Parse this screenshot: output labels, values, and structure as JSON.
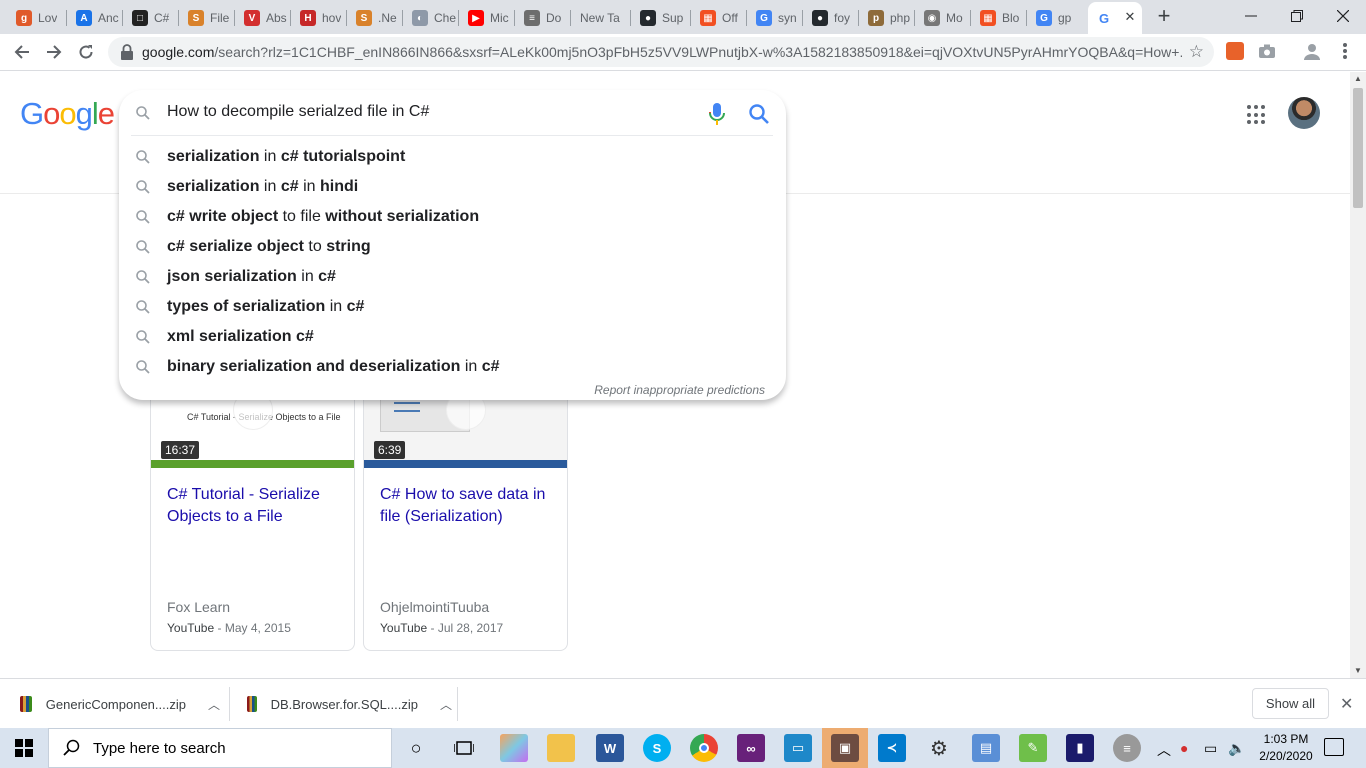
{
  "browser": {
    "tabs": [
      {
        "label": "Lov",
        "favicon": "ginger-favicon",
        "color": "#e05a2a",
        "glyph": "g"
      },
      {
        "label": "Anc",
        "favicon": "android-favicon",
        "color": "#1a73e8",
        "glyph": "A"
      },
      {
        "label": "C#",
        "favicon": "tutorial-favicon",
        "color": "#222222",
        "glyph": "□"
      },
      {
        "label": "File",
        "favicon": "stackoverflow-favicon",
        "color": "#d9822b",
        "glyph": "S"
      },
      {
        "label": "Abs",
        "favicon": "v-favicon",
        "color": "#d32f2f",
        "glyph": "V"
      },
      {
        "label": "hov",
        "favicon": "h-favicon",
        "color": "#c62828",
        "glyph": "H"
      },
      {
        "label": ".Ne",
        "favicon": "stackoverflow-favicon",
        "color": "#d9822b",
        "glyph": "S"
      },
      {
        "label": "Che",
        "favicon": "chrome-ext-favicon",
        "color": "#8e99a8",
        "glyph": "◐"
      },
      {
        "label": "Mic",
        "favicon": "youtube-favicon",
        "color": "#ff0000",
        "glyph": "▶"
      },
      {
        "label": "Do",
        "favicon": "database-favicon",
        "color": "#6d6d6d",
        "glyph": "≡"
      },
      {
        "label": "New Ta",
        "favicon": "",
        "color": "",
        "glyph": ""
      },
      {
        "label": "Sup",
        "favicon": "github-favicon",
        "color": "#24292e",
        "glyph": "●"
      },
      {
        "label": "Off",
        "favicon": "microsoft-favicon",
        "color": "#f25022",
        "glyph": "▦"
      },
      {
        "label": "syn",
        "favicon": "google-favicon",
        "color": "#4285f4",
        "glyph": "G"
      },
      {
        "label": "foy",
        "favicon": "github-favicon",
        "color": "#24292e",
        "glyph": "●"
      },
      {
        "label": "php",
        "favicon": "php-favicon",
        "color": "#8e6b3a",
        "glyph": "p"
      },
      {
        "label": "Mo",
        "favicon": "web-favicon",
        "color": "#777777",
        "glyph": "◉"
      },
      {
        "label": "Blo",
        "favicon": "microsoft-favicon",
        "color": "#f25022",
        "glyph": "▦"
      },
      {
        "label": "gp",
        "favicon": "google-favicon",
        "color": "#4285f4",
        "glyph": "G"
      }
    ],
    "active_tab": {
      "favicon": "google-favicon",
      "glyph": "G",
      "close": "✕"
    },
    "new_tab": "+",
    "url_host": "google.com",
    "url_rest": "/search?rlz=1C1CHBF_enIN866IN866&sxsrf=ALeKk00mj5nO3pFbH5z5VV9LWPnutjbX-w%3A1582183850918&ei=qjVOXtvUN5PyrAHmrYOQBA&q=How+..."
  },
  "google": {
    "logo_letters": [
      {
        "ch": "G",
        "color": "#4285f4"
      },
      {
        "ch": "o",
        "color": "#ea4335"
      },
      {
        "ch": "o",
        "color": "#fbbc05"
      },
      {
        "ch": "g",
        "color": "#4285f4"
      },
      {
        "ch": "l",
        "color": "#34a853"
      },
      {
        "ch": "e",
        "color": "#ea4335"
      }
    ],
    "query": "How to decompile serialzed file in C#",
    "suggestions": [
      [
        {
          "t": "serialization",
          "b": true
        },
        {
          "t": " in ",
          "b": false
        },
        {
          "t": "c# tutorialspoint",
          "b": true
        }
      ],
      [
        {
          "t": "serialization",
          "b": true
        },
        {
          "t": " in ",
          "b": false
        },
        {
          "t": "c#",
          "b": true
        },
        {
          "t": " in ",
          "b": false
        },
        {
          "t": "hindi",
          "b": true
        }
      ],
      [
        {
          "t": "c# write object",
          "b": true
        },
        {
          "t": " to file ",
          "b": false
        },
        {
          "t": "without serialization",
          "b": true
        }
      ],
      [
        {
          "t": "c# serialize object",
          "b": true
        },
        {
          "t": " to ",
          "b": false
        },
        {
          "t": "string",
          "b": true
        }
      ],
      [
        {
          "t": "json serialization",
          "b": true
        },
        {
          "t": " in ",
          "b": false
        },
        {
          "t": "c#",
          "b": true
        }
      ],
      [
        {
          "t": "types of serialization",
          "b": true
        },
        {
          "t": " in ",
          "b": false
        },
        {
          "t": "c#",
          "b": true
        }
      ],
      [
        {
          "t": "xml serialization c#",
          "b": true
        }
      ],
      [
        {
          "t": "binary serialization and deserialization",
          "b": true
        },
        {
          "t": " in ",
          "b": false
        },
        {
          "t": "c#",
          "b": true
        }
      ]
    ],
    "report_link": "Report inappropriate predictions"
  },
  "videos": [
    {
      "duration": "16:37",
      "title": "C# Tutorial - Serialize Objects to a File",
      "thumb_caption": "C# Tutorial - Serialize Objects to a File",
      "source": "Fox Learn",
      "platform": "YouTube",
      "date": " - May 4, 2015"
    },
    {
      "duration": "6:39",
      "title": "C# How to save data in file (Serialization)",
      "source": "OhjelmointiTuuba",
      "platform": "YouTube",
      "date": " - Jul 28, 2017"
    }
  ],
  "downloads": [
    {
      "name": "GenericComponen....zip"
    },
    {
      "name": "DB.Browser.for.SQL....zip"
    }
  ],
  "show_all": "Show all",
  "taskbar": {
    "search_placeholder": "Type here to search",
    "time": "1:03 PM",
    "date": "2/20/2020"
  }
}
